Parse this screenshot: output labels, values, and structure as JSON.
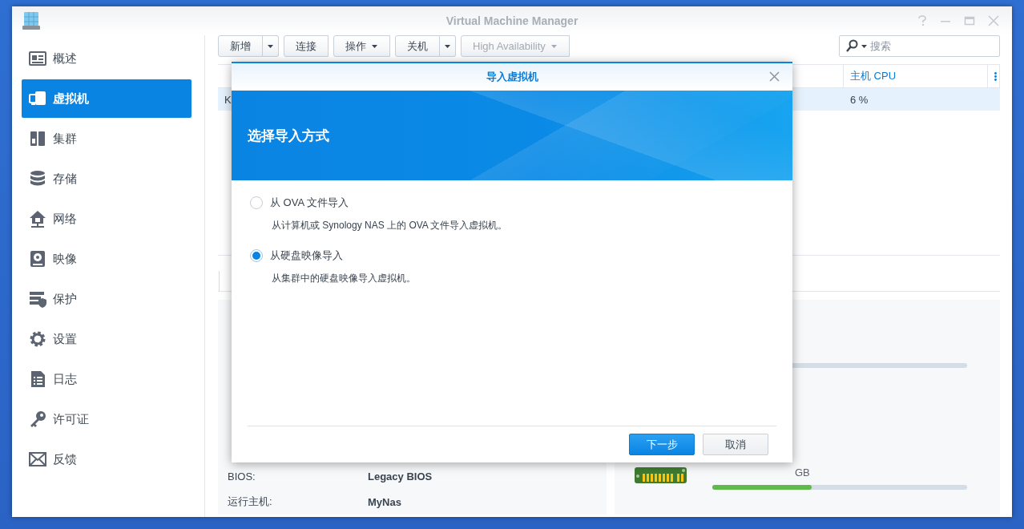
{
  "window": {
    "title": "Virtual Machine Manager"
  },
  "sidebar": {
    "items": [
      {
        "label": "概述",
        "kind": "overview",
        "selected": false
      },
      {
        "label": "虚拟机",
        "kind": "vm",
        "selected": true
      },
      {
        "label": "集群",
        "kind": "cluster",
        "selected": false
      },
      {
        "label": "存储",
        "kind": "storage",
        "selected": false
      },
      {
        "label": "网络",
        "kind": "network",
        "selected": false
      },
      {
        "label": "映像",
        "kind": "image",
        "selected": false
      },
      {
        "label": "保护",
        "kind": "protection",
        "selected": false
      },
      {
        "label": "设置",
        "kind": "settings",
        "selected": false
      },
      {
        "label": "日志",
        "kind": "log",
        "selected": false
      },
      {
        "label": "许可证",
        "kind": "license",
        "selected": false
      },
      {
        "label": "反馈",
        "kind": "feedback",
        "selected": false
      }
    ]
  },
  "toolbar": {
    "buttons": [
      {
        "label": "新增",
        "split": true,
        "menu": false,
        "disabled": false
      },
      {
        "label": "连接",
        "split": false,
        "menu": false,
        "disabled": false
      },
      {
        "label": "操作",
        "split": false,
        "menu": true,
        "disabled": false
      },
      {
        "label": "关机",
        "split": true,
        "menu": false,
        "disabled": false
      },
      {
        "label": "High Availability",
        "split": false,
        "menu": true,
        "disabled": true
      }
    ]
  },
  "search": {
    "placeholder": "搜索"
  },
  "table": {
    "columns": [
      "",
      "主机 CPU"
    ],
    "rows": [
      {
        "cells": [
          "K",
          "6 %"
        ],
        "selected": true
      }
    ]
  },
  "details": {
    "rows": [
      {
        "label": "BIOS:",
        "value": "Legacy BIOS"
      },
      {
        "label": "运行主机:",
        "value": "MyNas"
      }
    ]
  },
  "resources": {
    "memory": {
      "reading": "GB",
      "level": 0.39
    }
  },
  "dialog": {
    "title": "导入虚拟机",
    "heading": "选择导入方式",
    "options": [
      {
        "label": "从 OVA 文件导入",
        "description": "从计算机或 Synology NAS 上的 OVA 文件导入虚拟机。",
        "selected": false
      },
      {
        "label": "从硬盘映像导入",
        "description": "从集群中的硬盘映像导入虚拟机。",
        "selected": true
      }
    ],
    "buttons": [
      {
        "label": "下一步",
        "kind": "primary"
      },
      {
        "label": "取消",
        "kind": "secondary"
      }
    ]
  }
}
